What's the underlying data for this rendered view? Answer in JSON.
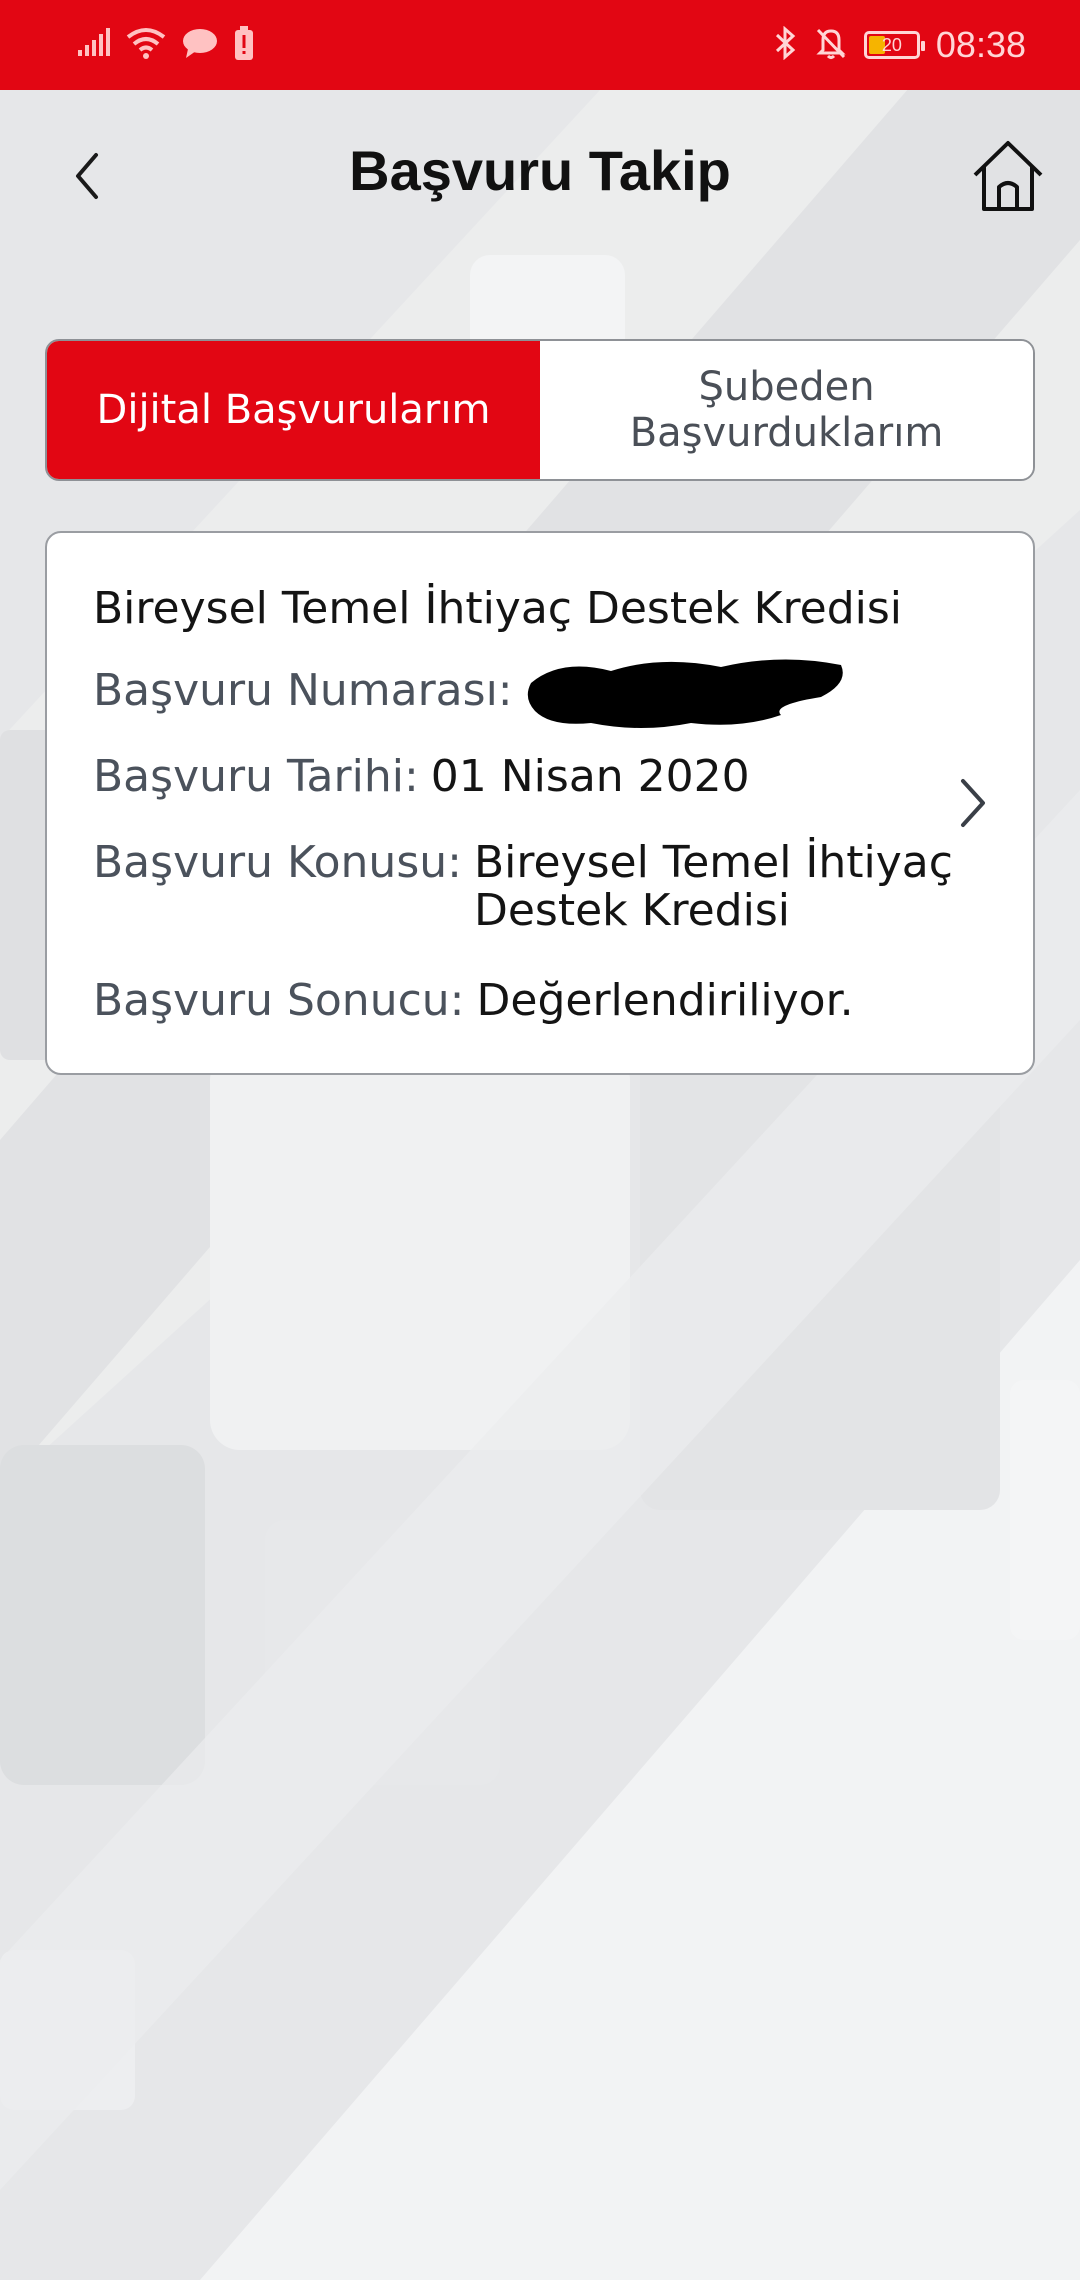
{
  "colors": {
    "accent": "#e20613",
    "status_bar": "#e20613"
  },
  "status_bar": {
    "time": "08:38",
    "battery": "20",
    "icons_left": [
      "signal-icon",
      "wifi-icon",
      "message-icon",
      "battery-alert-icon"
    ],
    "icons_right": [
      "bluetooth-icon",
      "notifications-off-icon",
      "battery-icon"
    ]
  },
  "header": {
    "title": "Başvuru Takip",
    "back_icon": "chevron-left-icon",
    "home_icon": "home-icon"
  },
  "tabs": [
    {
      "label": "Dijital Başvurularım",
      "active": true
    },
    {
      "label": "Şubeden\nBaşvurduklarım",
      "active": false
    }
  ],
  "application": {
    "title": "Bireysel Temel İhtiyaç Destek Kredisi",
    "number_label": "Başvuru Numarası:",
    "date_label": "Başvuru Tarihi:",
    "date_value": "01 Nisan 2020",
    "subject_label": "Başvuru Konusu:",
    "subject_value": "Bireysel Temel İhtiyaç Destek Kredisi",
    "result_label": "Başvuru Sonucu:",
    "result_value": "Değerlendiriliyor."
  }
}
